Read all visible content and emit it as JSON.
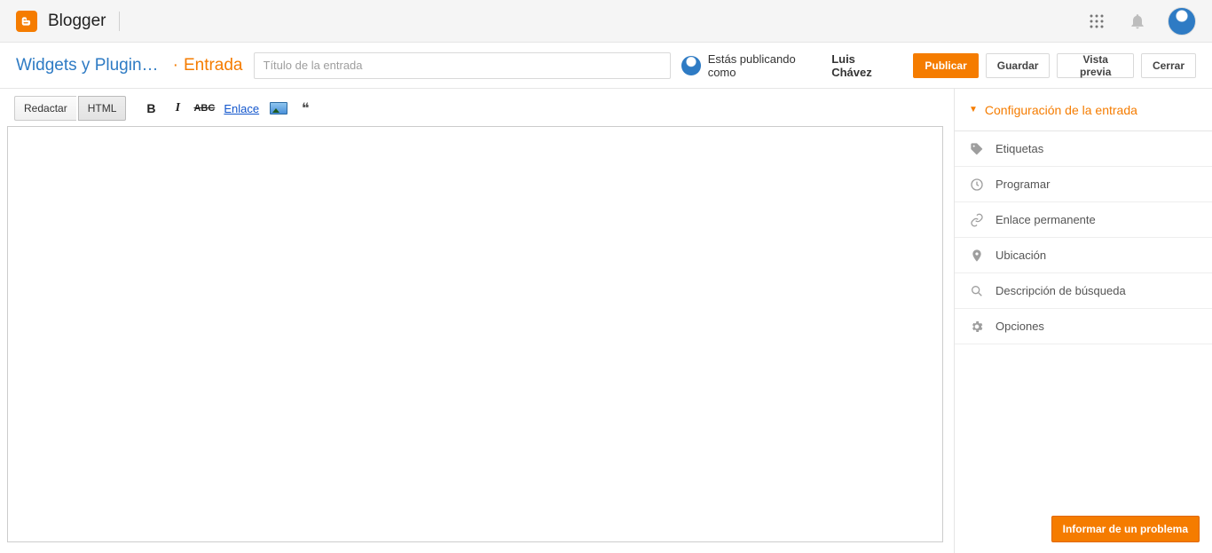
{
  "topbar": {
    "brand": "Blogger"
  },
  "header": {
    "blog_name": "Widgets y Plugins ...",
    "separator": "·",
    "page_label": "Entrada",
    "title_placeholder": "Título de la entrada",
    "title_value": "",
    "posting_as_prefix": "Estás publicando como",
    "username": "Luis Chávez",
    "buttons": {
      "publish": "Publicar",
      "save": "Guardar",
      "preview": "Vista previa",
      "close": "Cerrar"
    }
  },
  "toolbar": {
    "mode_compose": "Redactar",
    "mode_html": "HTML",
    "bold": "B",
    "italic": "I",
    "strike": "ABC",
    "link": "Enlace",
    "quote": "❝"
  },
  "sidebar": {
    "header": "Configuración de la entrada",
    "items": [
      {
        "label": "Etiquetas"
      },
      {
        "label": "Programar"
      },
      {
        "label": "Enlace permanente"
      },
      {
        "label": "Ubicación"
      },
      {
        "label": "Descripción de búsqueda"
      },
      {
        "label": "Opciones"
      }
    ]
  },
  "footer": {
    "report": "Informar de un problema"
  }
}
